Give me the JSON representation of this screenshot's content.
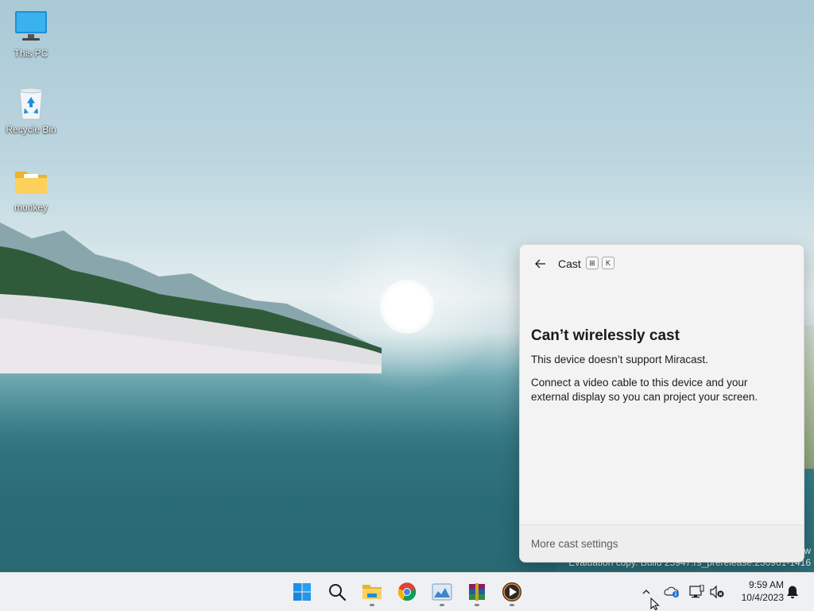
{
  "desktop": {
    "icons": [
      {
        "label": "This PC",
        "icon": "monitor-icon"
      },
      {
        "label": "Recycle Bin",
        "icon": "recycle-bin-icon"
      },
      {
        "label": "monkey",
        "icon": "folder-icon"
      }
    ],
    "watermark": {
      "line1": "w",
      "line2": "Evaluation copy. Build 25947.rs_prerelease.230901-1416"
    }
  },
  "cast_panel": {
    "title": "Cast",
    "shortcut_keys": [
      "⊞",
      "K"
    ],
    "heading": "Can’t wirelessly cast",
    "message": "This device doesn’t support Miracast.",
    "instructions": "Connect a video cable to this device and your external display so you can project your screen.",
    "footer_link": "More cast settings"
  },
  "taskbar": {
    "apps": [
      "start-icon",
      "search-icon",
      "file-explorer-icon",
      "chrome-icon",
      "photos-icon",
      "winrar-icon",
      "media-player-icon"
    ],
    "tray": {
      "chevron": "chevron-up-icon",
      "icons": [
        "onedrive-icon",
        "network-icon",
        "volume-muted-icon"
      ],
      "time": "9:59 AM",
      "date": "10/4/2023",
      "notification": "bell-icon"
    }
  },
  "colors": {
    "accent": "#0067c0",
    "panel_bg": "#f3f3f3",
    "taskbar_bg": "#eef0f3"
  }
}
